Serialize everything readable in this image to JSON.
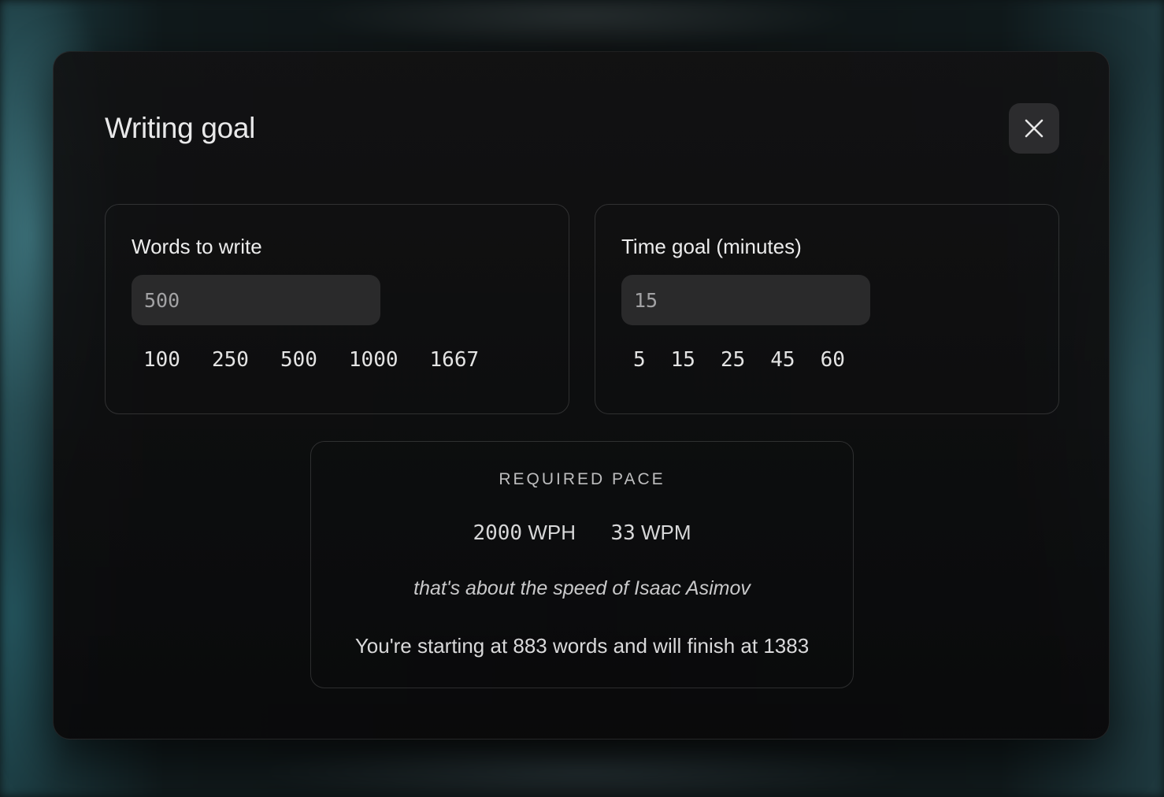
{
  "modal": {
    "title": "Writing goal",
    "close_icon": "close-icon"
  },
  "words_panel": {
    "label": "Words to write",
    "input_value": "500",
    "presets": [
      "100",
      "250",
      "500",
      "1000",
      "1667"
    ]
  },
  "time_panel": {
    "label": "Time goal (minutes)",
    "input_value": "15",
    "presets": [
      "5",
      "15",
      "25",
      "45",
      "60"
    ]
  },
  "pace": {
    "heading": "REQUIRED PACE",
    "wph_number": "2000",
    "wph_unit": "WPH",
    "wpm_number": "33",
    "wpm_unit": "WPM",
    "comparison": "that's about the speed of Isaac Asimov",
    "summary": "You're starting at 883 words and will finish at 1383"
  }
}
